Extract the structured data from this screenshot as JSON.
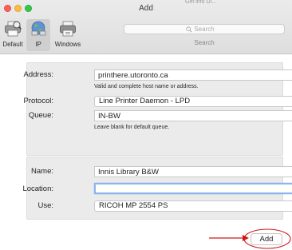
{
  "window": {
    "title": "Add",
    "background_window_fragment": "Get info Di..."
  },
  "toolbar": {
    "items": [
      {
        "label": "Default",
        "icon": "printer-default-icon"
      },
      {
        "label": "IP",
        "icon": "globe-network-icon",
        "selected": true
      },
      {
        "label": "Windows",
        "icon": "windows-printer-icon"
      }
    ],
    "search": {
      "placeholder": "Search",
      "label": "Search"
    }
  },
  "form": {
    "address": {
      "label": "Address:",
      "value": "printhere.utoronto.ca",
      "hint": "Valid and complete host name or address."
    },
    "protocol": {
      "label": "Protocol:",
      "value": "Line Printer Daemon - LPD"
    },
    "queue": {
      "label": "Queue:",
      "value": "IN-BW",
      "hint": "Leave blank for default queue."
    },
    "name": {
      "label": "Name:",
      "value": "Innis Library B&W"
    },
    "location": {
      "label": "Location:",
      "value": ""
    },
    "use": {
      "label": "Use:",
      "value": "RICOH MP 2554 PS"
    }
  },
  "actions": {
    "add_label": "Add"
  },
  "colors": {
    "accent": "#3a83f6",
    "annotation": "#d0171c",
    "focus_ring": "#8fb3f0"
  }
}
